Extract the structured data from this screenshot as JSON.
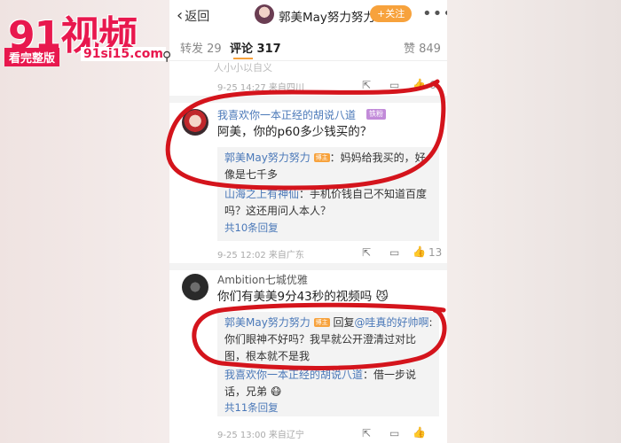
{
  "watermark": {
    "main_text": "91视频",
    "sub_label": "看完整版",
    "url": "91si15.com"
  },
  "header": {
    "back_label": "返回",
    "title": "郭美May努力努力",
    "follow_label": "+关注",
    "more_icon": "more-horizontal-icon"
  },
  "tabs": {
    "repost": "转发 29",
    "comments": "评论 317",
    "likes": "赞 849"
  },
  "peek": {
    "text": "人小小以自义",
    "meta": "9-25 14:27 来自四川",
    "like_count": "6"
  },
  "comment1": {
    "name": "我喜欢你一本正经的胡说八道",
    "badge": "铁粉",
    "text": "阿美，你的p60多少钱买的？",
    "replies": [
      {
        "name": "郭美May努力努力",
        "owner": "博主",
        "text": "：妈妈给我买的，好像是七千多"
      },
      {
        "name": "山海之上有神仙",
        "owner": "",
        "text": "：手机价钱自己不知道百度吗？这还用问人本人？"
      }
    ],
    "more_replies": "共10条回复",
    "meta": "9-25 12:02 来自广东",
    "like_count": "13"
  },
  "comment2": {
    "name": "Ambition七城优雅",
    "text": "你们有美美9分43秒的视频吗",
    "replies": [
      {
        "name": "郭美May努力努力",
        "owner": "博主",
        "text": " 回复",
        "mention": "@哇真的好帅啊",
        "text2": ":你们眼神不好吗？我早就公开澄清过对比图，根本就不是我"
      },
      {
        "name": "我喜欢你一本正经的胡说八道",
        "owner": "",
        "text": "：借一步说话，兄弟"
      }
    ],
    "more_replies": "共11条回复",
    "meta": "9-25 13:00 来自辽宁"
  },
  "colors": {
    "accent": "#f7a23c",
    "link": "#4a78b8",
    "watermark": "#e8184e",
    "scribble": "#d4141c"
  }
}
